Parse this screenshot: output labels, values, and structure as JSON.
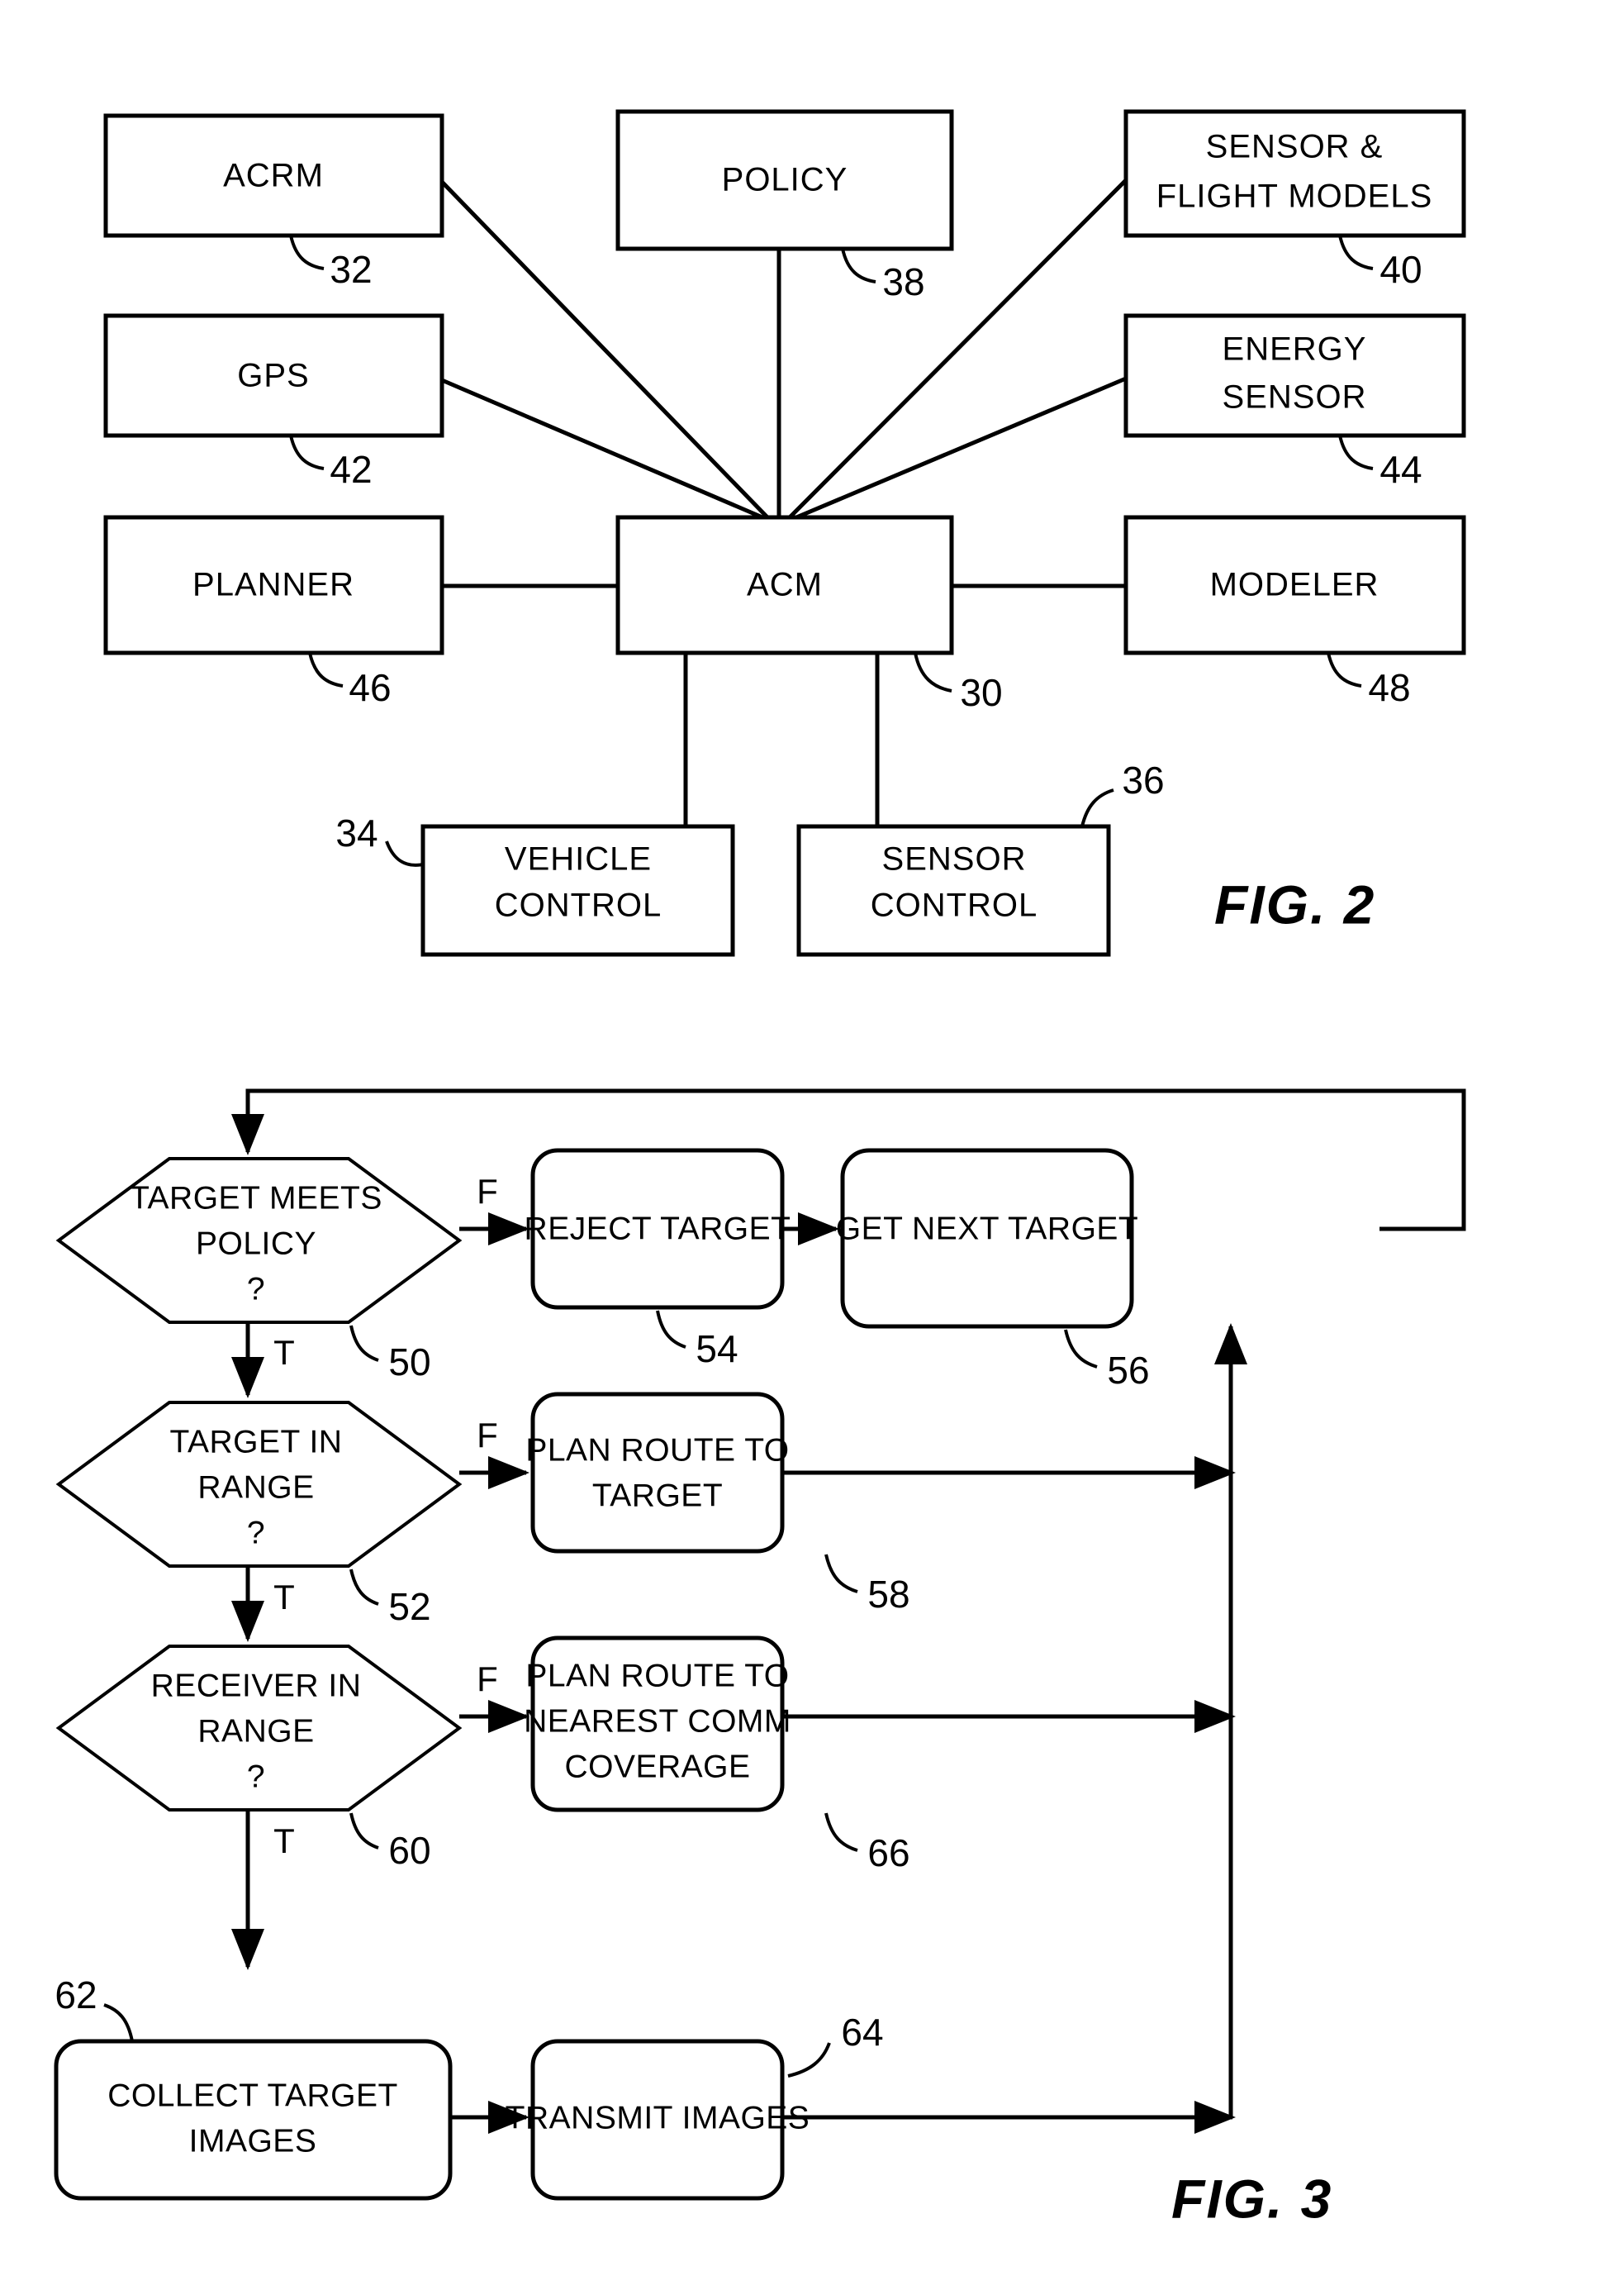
{
  "figures": [
    {
      "id": "fig2",
      "caption": "FIG. 2",
      "type": "block-diagram",
      "nodes": [
        {
          "ref": "32",
          "label": "ACRM",
          "shape": "rect"
        },
        {
          "ref": "38",
          "label": "POLICY",
          "shape": "rect"
        },
        {
          "ref": "40",
          "label": "SENSOR  &",
          "label2": "FLIGHT MODELS",
          "shape": "rect"
        },
        {
          "ref": "42",
          "label": "GPS",
          "shape": "rect"
        },
        {
          "ref": "44",
          "label": "ENERGY",
          "label2": "SENSOR",
          "shape": "rect"
        },
        {
          "ref": "46",
          "label": "PLANNER",
          "shape": "rect"
        },
        {
          "ref": "30",
          "label": "ACM",
          "shape": "rect"
        },
        {
          "ref": "48",
          "label": "MODELER",
          "shape": "rect"
        },
        {
          "ref": "34",
          "label": "VEHICLE",
          "label2": "CONTROL",
          "shape": "rect"
        },
        {
          "ref": "36",
          "label": "SENSOR",
          "label2": "CONTROL",
          "shape": "rect"
        }
      ],
      "edges": [
        {
          "from": "32",
          "to": "30"
        },
        {
          "from": "38",
          "to": "30"
        },
        {
          "from": "40",
          "to": "30"
        },
        {
          "from": "42",
          "to": "30"
        },
        {
          "from": "44",
          "to": "30"
        },
        {
          "from": "46",
          "to": "30"
        },
        {
          "from": "30",
          "to": "48"
        },
        {
          "from": "30",
          "to": "34"
        },
        {
          "from": "30",
          "to": "36"
        }
      ]
    },
    {
      "id": "fig3",
      "caption": "FIG. 3",
      "type": "flowchart",
      "nodes": [
        {
          "ref": "50",
          "label": "TARGET MEETS",
          "label2": "POLICY",
          "label3": "?",
          "shape": "hexagon"
        },
        {
          "ref": "54",
          "label": "REJECT TARGET",
          "shape": "rounded-rect"
        },
        {
          "ref": "56",
          "label": "GET NEXT TARGET",
          "shape": "rounded-rect"
        },
        {
          "ref": "52",
          "label": "TARGET IN",
          "label2": "RANGE",
          "label3": "?",
          "shape": "hexagon"
        },
        {
          "ref": "58",
          "label": "PLAN ROUTE TO",
          "label2": "TARGET",
          "shape": "rounded-rect"
        },
        {
          "ref": "60",
          "label": "RECEIVER IN",
          "label2": "RANGE",
          "label3": "?",
          "shape": "hexagon"
        },
        {
          "ref": "66",
          "label": "PLAN ROUTE TO",
          "label2": "NEAREST COMM",
          "label3": "COVERAGE",
          "shape": "rounded-rect"
        },
        {
          "ref": "62",
          "label": "COLLECT TARGET",
          "label2": "IMAGES",
          "shape": "rounded-rect"
        },
        {
          "ref": "64",
          "label": "TRANSMIT IMAGES",
          "shape": "rounded-rect"
        }
      ],
      "branch_labels": {
        "true": "T",
        "false": "F"
      },
      "edges": [
        {
          "from": "50",
          "to": "54",
          "label": "F"
        },
        {
          "from": "50",
          "to": "52",
          "label": "T"
        },
        {
          "from": "54",
          "to": "56",
          "label": ""
        },
        {
          "from": "56",
          "to": "50",
          "label": ""
        },
        {
          "from": "52",
          "to": "58",
          "label": "F"
        },
        {
          "from": "52",
          "to": "60",
          "label": "T"
        },
        {
          "from": "58",
          "to": "56",
          "label": ""
        },
        {
          "from": "60",
          "to": "66",
          "label": "F"
        },
        {
          "from": "60",
          "to": "62",
          "label": "T"
        },
        {
          "from": "66",
          "to": "56",
          "label": ""
        },
        {
          "from": "62",
          "to": "64",
          "label": ""
        },
        {
          "from": "64",
          "to": "56",
          "label": ""
        }
      ]
    }
  ],
  "colors": {
    "ink": "#000000",
    "paper": "#ffffff"
  }
}
